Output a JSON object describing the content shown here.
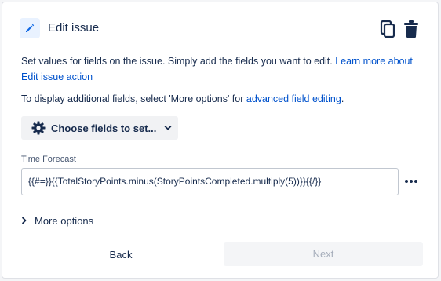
{
  "header": {
    "title": "Edit issue",
    "icon": "pencil-icon",
    "actions": [
      "copy-icon",
      "trash-icon"
    ]
  },
  "description": {
    "text": "Set values for fields on the issue. Simply add the fields you want to edit. ",
    "link": "Learn more about Edit issue action"
  },
  "additional": {
    "text": "To display additional fields, select 'More options' for ",
    "link": "advanced field editing",
    "suffix": "."
  },
  "choose_fields": {
    "label": "Choose fields to set...",
    "icon": "gear-icon"
  },
  "field": {
    "label": "Time Forecast",
    "value": "{{#=}}{{TotalStoryPoints.minus(StoryPointsCompleted.multiply(5))}}{{/}}"
  },
  "more_options": {
    "label": "More options"
  },
  "footer": {
    "back_label": "Back",
    "next_label": "Next"
  },
  "colors": {
    "link": "#0052cc",
    "text": "#172b4d",
    "disabled_text": "#a5adba",
    "icon_bg": "#e9f2ff"
  }
}
